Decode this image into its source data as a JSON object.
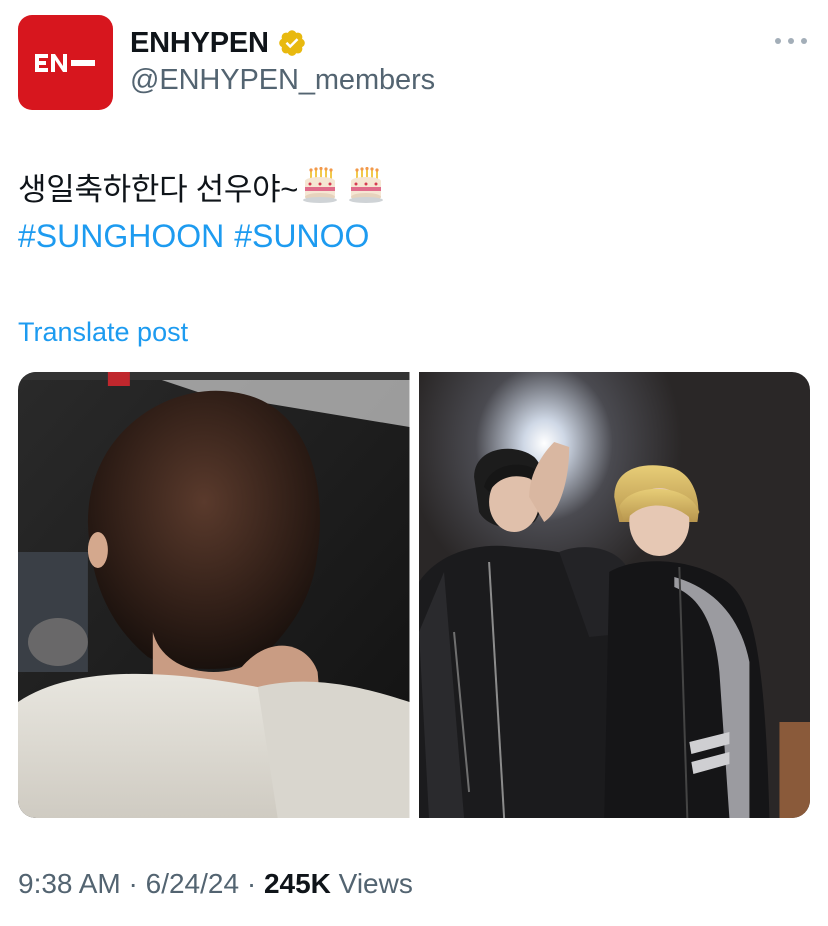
{
  "account": {
    "display_name": "ENHYPEN",
    "handle": "@ENHYPEN_members",
    "avatar_text": "EN−",
    "avatar_color": "#d7161e",
    "verified": true,
    "verified_color": "#e8b90f"
  },
  "post": {
    "text": "생일축하한다 선우야~",
    "emoji": [
      "birthday-cake-icon",
      "birthday-cake-icon"
    ],
    "hashtags": [
      "#SUNGHOON",
      "#SUNOO"
    ],
    "translate_label": "Translate post",
    "media": [
      {
        "icon": "photo-back-of-head"
      },
      {
        "icon": "photo-mirror-selfie"
      }
    ]
  },
  "meta": {
    "time": "9:38 AM",
    "separator": " · ",
    "date": "6/24/24",
    "views_count": "245K",
    "views_label": "Views"
  },
  "colors": {
    "link": "#1d9bf0",
    "secondary_text": "#536471",
    "primary_text": "#0f1419"
  }
}
